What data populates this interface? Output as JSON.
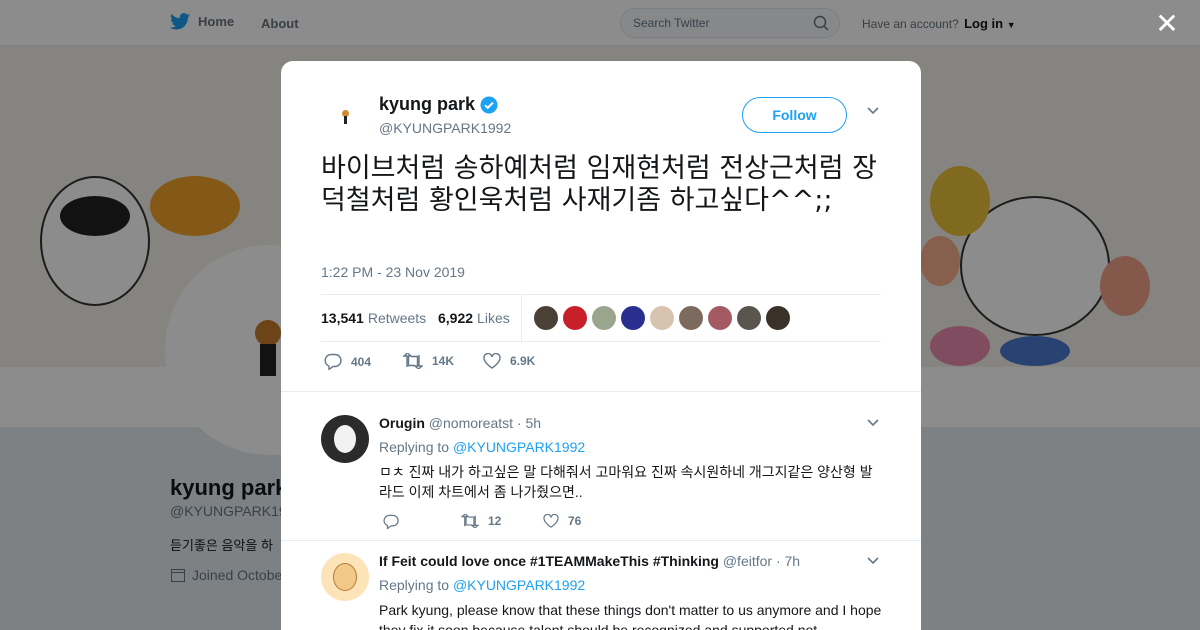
{
  "topnav": {
    "home_label": "Home",
    "about_label": "About",
    "search_placeholder": "Search Twitter",
    "account_prompt": "Have an account?",
    "login_label": "Log in"
  },
  "profile": {
    "name": "kyung park",
    "handle": "@KYUNGPARK19",
    "bio": "듣기좋은 음악을 하",
    "joined": "Joined Octobe"
  },
  "tweet": {
    "author_name": "kyung park",
    "author_handle": "@KYUNGPARK1992",
    "follow_label": "Follow",
    "text": "바이브처럼 송하예처럼 임재현처럼 전상근처럼 장덕철처럼 황인욱처럼 사재기좀 하고싶다^^;;",
    "timestamp": "1:22 PM - 23 Nov 2019",
    "retweets_count": "13,541",
    "retweets_label": "Retweets",
    "likes_count": "6,922",
    "likes_label": "Likes",
    "reply_count": "404",
    "retweet_count_short": "14K",
    "like_count_short": "6.9K",
    "liker_colors": [
      "#4a4036",
      "#c8202a",
      "#9aa58e",
      "#2a2f8f",
      "#d8c3b0",
      "#7d6a5e",
      "#a35a62",
      "#5b5550",
      "#3a3228"
    ]
  },
  "replies": [
    {
      "name": "Orugin",
      "handle": "@nomoreatst",
      "time": "· 5h",
      "replying_prefix": "Replying to",
      "replying_to": "@KYUNGPARK1992",
      "text": "ㅁㅊ 진짜 내가 하고싶은 말 다해줘서 고마워요 진짜 속시원하네 개그지같은 양산형 발라드 이제 차트에서 좀 나가줬으면..",
      "retweets": "12",
      "likes": "76",
      "avatar_color": "#2b2b2b"
    },
    {
      "name": "If Feit could love once #1TEAMMakeThis #Thinking",
      "handle": "@feitfor",
      "time": "· 7h",
      "replying_prefix": "Replying to",
      "replying_to": "@KYUNGPARK1992",
      "text": "Park kyung, please know that these things don't matter to us anymore and I hope they fix it soon because talent should be recognized and supported not",
      "avatar_color": "#f3c98a"
    }
  ],
  "colors": {
    "twitter_blue": "#1da1f2",
    "text_primary": "#14171a",
    "text_secondary": "#657786"
  }
}
